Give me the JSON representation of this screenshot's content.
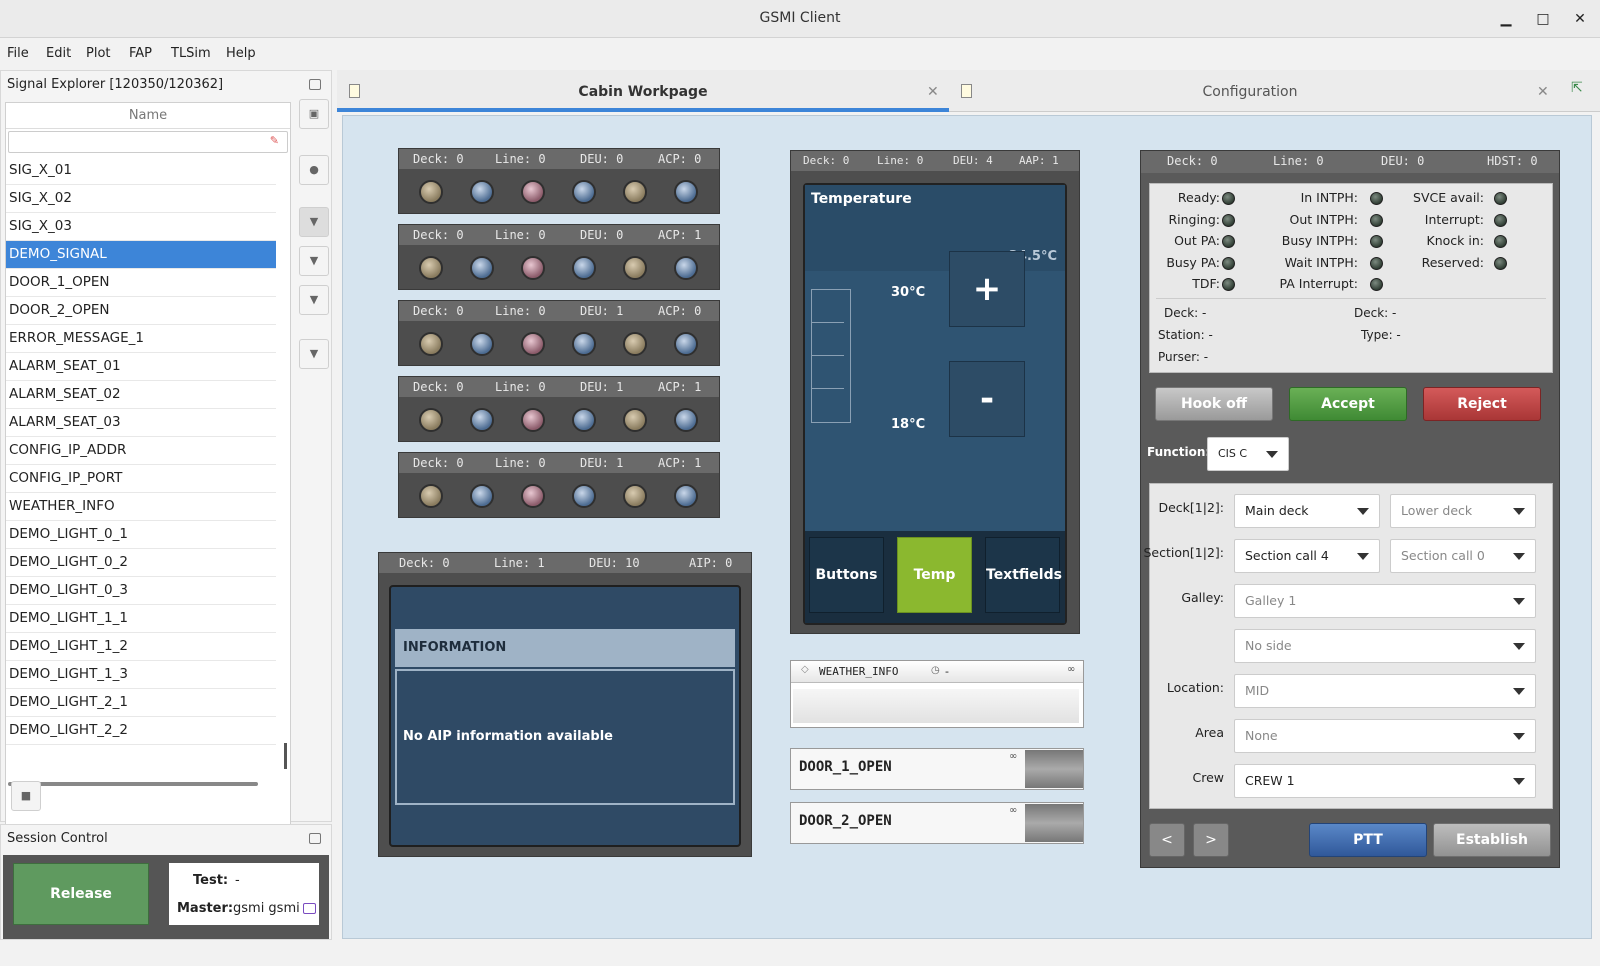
{
  "window": {
    "title": "GSMI Client"
  },
  "menu": [
    "File",
    "Edit",
    "Plot",
    "FAP",
    "TLSim",
    "Help"
  ],
  "signal_explorer": {
    "title": "Signal Explorer [120350/120362]",
    "column": "Name",
    "signals": [
      "SIG_X_01",
      "SIG_X_02",
      "SIG_X_03",
      "DEMO_SIGNAL",
      "DOOR_1_OPEN",
      "DOOR_2_OPEN",
      "ERROR_MESSAGE_1",
      "ALARM_SEAT_01",
      "ALARM_SEAT_02",
      "ALARM_SEAT_03",
      "CONFIG_IP_ADDR",
      "CONFIG_IP_PORT",
      "WEATHER_INFO",
      "DEMO_LIGHT_0_1",
      "DEMO_LIGHT_0_2",
      "DEMO_LIGHT_0_3",
      "DEMO_LIGHT_1_1",
      "DEMO_LIGHT_1_2",
      "DEMO_LIGHT_1_3",
      "DEMO_LIGHT_2_1",
      "DEMO_LIGHT_2_2"
    ],
    "selected": "DEMO_SIGNAL"
  },
  "session": {
    "title": "Session Control",
    "release_label": "Release",
    "test_label": "Test:",
    "test_value": "-",
    "master_label": "Master:",
    "master_value": "gsmi gsmi"
  },
  "tabs": [
    {
      "label": "Cabin Workpage",
      "active": true
    },
    {
      "label": "Configuration",
      "active": false
    }
  ],
  "acp_panels": [
    {
      "deck": "Deck: 0",
      "line": "Line: 0",
      "deu": "DEU: 0",
      "acp": "ACP: 0"
    },
    {
      "deck": "Deck: 0",
      "line": "Line: 0",
      "deu": "DEU: 0",
      "acp": "ACP: 1"
    },
    {
      "deck": "Deck: 0",
      "line": "Line: 0",
      "deu": "DEU: 1",
      "acp": "ACP: 0"
    },
    {
      "deck": "Deck: 0",
      "line": "Line: 0",
      "deu": "DEU: 1",
      "acp": "ACP: 1"
    },
    {
      "deck": "Deck: 0",
      "line": "Line: 0",
      "deu": "DEU: 1",
      "acp": "ACP: 1"
    }
  ],
  "aip": {
    "deck": "Deck: 0",
    "line": "Line: 1",
    "deu": "DEU: 10",
    "aip": "AIP: 0",
    "header": "INFORMATION",
    "message": "No AIP information available"
  },
  "aap": {
    "deck": "Deck: 0",
    "line": "Line: 0",
    "deu": "DEU: 4",
    "aap": "AAP: 1",
    "title": "Temperature",
    "current": "24.5°C",
    "max": "30°C",
    "min": "18°C",
    "plus": "+",
    "minus": "-",
    "tabs": [
      "Buttons",
      "Temp",
      "Textfields"
    ],
    "active_tab": "Temp"
  },
  "weather_widget": {
    "name": "WEATHER_INFO",
    "value": "-"
  },
  "door_widgets": [
    "DOOR_1_OPEN",
    "DOOR_2_OPEN"
  ],
  "hdst": {
    "deck": "Deck: 0",
    "line": "Line: 0",
    "deu": "DEU: 0",
    "hdst": "HDST: 0",
    "status_col1": [
      "Ready:",
      "Ringing:",
      "Out PA:",
      "Busy PA:",
      "TDF:"
    ],
    "status_col2": [
      "In INTPH:",
      "Out INTPH:",
      "Busy INTPH:",
      "Wait INTPH:",
      "PA Interrupt:"
    ],
    "status_col3": [
      "SVCE avail:",
      "Interrupt:",
      "Knock in:",
      "Reserved:"
    ],
    "info": {
      "deck1": "Deck: -",
      "deck2": "Deck: -",
      "station": "Station: -",
      "type": "Type: -",
      "purser": "Purser: -"
    },
    "hook_off": "Hook off",
    "accept": "Accept",
    "reject": "Reject",
    "function_label": "Function:",
    "function_value": "CIS C",
    "fields": [
      {
        "label": "Deck[1|2]:",
        "v1": "Main deck",
        "v2": "Lower deck"
      },
      {
        "label": "Section[1|2]:",
        "v1": "Section call 4",
        "v2": "Section call 0"
      },
      {
        "label": "Galley:",
        "v1": "Galley 1"
      },
      {
        "label": "",
        "v1": "No side"
      },
      {
        "label": "Location:",
        "v1": "MID"
      },
      {
        "label": "Area",
        "v1": "None"
      },
      {
        "label": "Crew",
        "v1": "CREW 1"
      }
    ],
    "prev": "<",
    "next": ">",
    "ptt": "PTT",
    "establish": "Establish"
  }
}
